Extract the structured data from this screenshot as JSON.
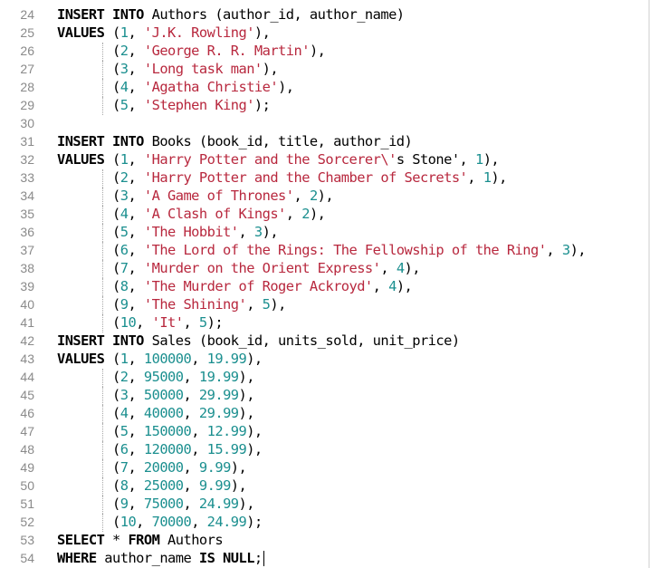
{
  "editor": {
    "lines": [
      {
        "n": "24",
        "tokens": [
          [
            "kw",
            "INSERT INTO"
          ],
          [
            "pl",
            " Authors (author_id, author_name)"
          ]
        ]
      },
      {
        "n": "25",
        "tokens": [
          [
            "kw",
            "VALUES"
          ],
          [
            "pl",
            " ("
          ],
          [
            "num",
            "1"
          ],
          [
            "pl",
            ", "
          ],
          [
            "str",
            "'J.K. Rowling'"
          ],
          [
            "pl",
            "),"
          ]
        ]
      },
      {
        "n": "26",
        "tokens": [
          [
            "pl",
            "       ("
          ],
          [
            "num",
            "2"
          ],
          [
            "pl",
            ", "
          ],
          [
            "str",
            "'George R. R. Martin'"
          ],
          [
            "pl",
            "),"
          ]
        ]
      },
      {
        "n": "27",
        "tokens": [
          [
            "pl",
            "       ("
          ],
          [
            "num",
            "3"
          ],
          [
            "pl",
            ", "
          ],
          [
            "str",
            "'Long task man'"
          ],
          [
            "pl",
            "),"
          ]
        ]
      },
      {
        "n": "28",
        "tokens": [
          [
            "pl",
            "       ("
          ],
          [
            "num",
            "4"
          ],
          [
            "pl",
            ", "
          ],
          [
            "str",
            "'Agatha Christie'"
          ],
          [
            "pl",
            "),"
          ]
        ]
      },
      {
        "n": "29",
        "tokens": [
          [
            "pl",
            "       ("
          ],
          [
            "num",
            "5"
          ],
          [
            "pl",
            ", "
          ],
          [
            "str",
            "'Stephen King'"
          ],
          [
            "pl",
            ");"
          ]
        ]
      },
      {
        "n": "30",
        "tokens": []
      },
      {
        "n": "31",
        "tokens": [
          [
            "kw",
            "INSERT INTO"
          ],
          [
            "pl",
            " Books (book_id, title, author_id)"
          ]
        ]
      },
      {
        "n": "32",
        "tokens": [
          [
            "kw",
            "VALUES"
          ],
          [
            "pl",
            " ("
          ],
          [
            "num",
            "1"
          ],
          [
            "pl",
            ", "
          ],
          [
            "str",
            "'Harry Potter and the Sorcerer\\'"
          ],
          [
            "pl",
            "s Stone', "
          ],
          [
            "num",
            "1"
          ],
          [
            "pl",
            "),"
          ]
        ]
      },
      {
        "n": "33",
        "tokens": [
          [
            "pl",
            "       ("
          ],
          [
            "num",
            "2"
          ],
          [
            "pl",
            ", "
          ],
          [
            "str",
            "'Harry Potter and the Chamber of Secrets'"
          ],
          [
            "pl",
            ", "
          ],
          [
            "num",
            "1"
          ],
          [
            "pl",
            "),"
          ]
        ]
      },
      {
        "n": "34",
        "tokens": [
          [
            "pl",
            "       ("
          ],
          [
            "num",
            "3"
          ],
          [
            "pl",
            ", "
          ],
          [
            "str",
            "'A Game of Thrones'"
          ],
          [
            "pl",
            ", "
          ],
          [
            "num",
            "2"
          ],
          [
            "pl",
            "),"
          ]
        ]
      },
      {
        "n": "35",
        "tokens": [
          [
            "pl",
            "       ("
          ],
          [
            "num",
            "4"
          ],
          [
            "pl",
            ", "
          ],
          [
            "str",
            "'A Clash of Kings'"
          ],
          [
            "pl",
            ", "
          ],
          [
            "num",
            "2"
          ],
          [
            "pl",
            "),"
          ]
        ]
      },
      {
        "n": "36",
        "tokens": [
          [
            "pl",
            "       ("
          ],
          [
            "num",
            "5"
          ],
          [
            "pl",
            ", "
          ],
          [
            "str",
            "'The Hobbit'"
          ],
          [
            "pl",
            ", "
          ],
          [
            "num",
            "3"
          ],
          [
            "pl",
            "),"
          ]
        ]
      },
      {
        "n": "37",
        "tokens": [
          [
            "pl",
            "       ("
          ],
          [
            "num",
            "6"
          ],
          [
            "pl",
            ", "
          ],
          [
            "str",
            "'The Lord of the Rings: The Fellowship of the Ring'"
          ],
          [
            "pl",
            ", "
          ],
          [
            "num",
            "3"
          ],
          [
            "pl",
            "),"
          ]
        ]
      },
      {
        "n": "38",
        "tokens": [
          [
            "pl",
            "       ("
          ],
          [
            "num",
            "7"
          ],
          [
            "pl",
            ", "
          ],
          [
            "str",
            "'Murder on the Orient Express'"
          ],
          [
            "pl",
            ", "
          ],
          [
            "num",
            "4"
          ],
          [
            "pl",
            "),"
          ]
        ]
      },
      {
        "n": "39",
        "tokens": [
          [
            "pl",
            "       ("
          ],
          [
            "num",
            "8"
          ],
          [
            "pl",
            ", "
          ],
          [
            "str",
            "'The Murder of Roger Ackroyd'"
          ],
          [
            "pl",
            ", "
          ],
          [
            "num",
            "4"
          ],
          [
            "pl",
            "),"
          ]
        ]
      },
      {
        "n": "40",
        "tokens": [
          [
            "pl",
            "       ("
          ],
          [
            "num",
            "9"
          ],
          [
            "pl",
            ", "
          ],
          [
            "str",
            "'The Shining'"
          ],
          [
            "pl",
            ", "
          ],
          [
            "num",
            "5"
          ],
          [
            "pl",
            "),"
          ]
        ]
      },
      {
        "n": "41",
        "tokens": [
          [
            "pl",
            "       ("
          ],
          [
            "num",
            "10"
          ],
          [
            "pl",
            ", "
          ],
          [
            "str",
            "'It'"
          ],
          [
            "pl",
            ", "
          ],
          [
            "num",
            "5"
          ],
          [
            "pl",
            ");"
          ]
        ]
      },
      {
        "n": "42",
        "tokens": [
          [
            "kw",
            "INSERT INTO"
          ],
          [
            "pl",
            " Sales (book_id, units_sold, unit_price)"
          ]
        ]
      },
      {
        "n": "43",
        "tokens": [
          [
            "kw",
            "VALUES"
          ],
          [
            "pl",
            " ("
          ],
          [
            "num",
            "1"
          ],
          [
            "pl",
            ", "
          ],
          [
            "num",
            "100000"
          ],
          [
            "pl",
            ", "
          ],
          [
            "num",
            "19.99"
          ],
          [
            "pl",
            "),"
          ]
        ]
      },
      {
        "n": "44",
        "tokens": [
          [
            "pl",
            "       ("
          ],
          [
            "num",
            "2"
          ],
          [
            "pl",
            ", "
          ],
          [
            "num",
            "95000"
          ],
          [
            "pl",
            ", "
          ],
          [
            "num",
            "19.99"
          ],
          [
            "pl",
            "),"
          ]
        ]
      },
      {
        "n": "45",
        "tokens": [
          [
            "pl",
            "       ("
          ],
          [
            "num",
            "3"
          ],
          [
            "pl",
            ", "
          ],
          [
            "num",
            "50000"
          ],
          [
            "pl",
            ", "
          ],
          [
            "num",
            "29.99"
          ],
          [
            "pl",
            "),"
          ]
        ]
      },
      {
        "n": "46",
        "tokens": [
          [
            "pl",
            "       ("
          ],
          [
            "num",
            "4"
          ],
          [
            "pl",
            ", "
          ],
          [
            "num",
            "40000"
          ],
          [
            "pl",
            ", "
          ],
          [
            "num",
            "29.99"
          ],
          [
            "pl",
            "),"
          ]
        ]
      },
      {
        "n": "47",
        "tokens": [
          [
            "pl",
            "       ("
          ],
          [
            "num",
            "5"
          ],
          [
            "pl",
            ", "
          ],
          [
            "num",
            "150000"
          ],
          [
            "pl",
            ", "
          ],
          [
            "num",
            "12.99"
          ],
          [
            "pl",
            "),"
          ]
        ]
      },
      {
        "n": "48",
        "tokens": [
          [
            "pl",
            "       ("
          ],
          [
            "num",
            "6"
          ],
          [
            "pl",
            ", "
          ],
          [
            "num",
            "120000"
          ],
          [
            "pl",
            ", "
          ],
          [
            "num",
            "15.99"
          ],
          [
            "pl",
            "),"
          ]
        ]
      },
      {
        "n": "49",
        "tokens": [
          [
            "pl",
            "       ("
          ],
          [
            "num",
            "7"
          ],
          [
            "pl",
            ", "
          ],
          [
            "num",
            "20000"
          ],
          [
            "pl",
            ", "
          ],
          [
            "num",
            "9.99"
          ],
          [
            "pl",
            "),"
          ]
        ]
      },
      {
        "n": "50",
        "tokens": [
          [
            "pl",
            "       ("
          ],
          [
            "num",
            "8"
          ],
          [
            "pl",
            ", "
          ],
          [
            "num",
            "25000"
          ],
          [
            "pl",
            ", "
          ],
          [
            "num",
            "9.99"
          ],
          [
            "pl",
            "),"
          ]
        ]
      },
      {
        "n": "51",
        "tokens": [
          [
            "pl",
            "       ("
          ],
          [
            "num",
            "9"
          ],
          [
            "pl",
            ", "
          ],
          [
            "num",
            "75000"
          ],
          [
            "pl",
            ", "
          ],
          [
            "num",
            "24.99"
          ],
          [
            "pl",
            "),"
          ]
        ]
      },
      {
        "n": "52",
        "tokens": [
          [
            "pl",
            "       ("
          ],
          [
            "num",
            "10"
          ],
          [
            "pl",
            ", "
          ],
          [
            "num",
            "70000"
          ],
          [
            "pl",
            ", "
          ],
          [
            "num",
            "24.99"
          ],
          [
            "pl",
            ");"
          ]
        ]
      },
      {
        "n": "53",
        "tokens": [
          [
            "kw",
            "SELECT"
          ],
          [
            "pl",
            " * "
          ],
          [
            "kw",
            "FROM"
          ],
          [
            "pl",
            " Authors"
          ]
        ]
      },
      {
        "n": "54",
        "tokens": [
          [
            "kw",
            "WHERE"
          ],
          [
            "pl",
            " author_name "
          ],
          [
            "kw",
            "IS NULL"
          ],
          [
            "pl",
            ";"
          ]
        ]
      }
    ],
    "colors": {
      "keyword": "#000000",
      "string": "#b8283e",
      "number": "#1b8f8f",
      "gutter": "#8a8a8a",
      "background": "#ffffff"
    }
  }
}
